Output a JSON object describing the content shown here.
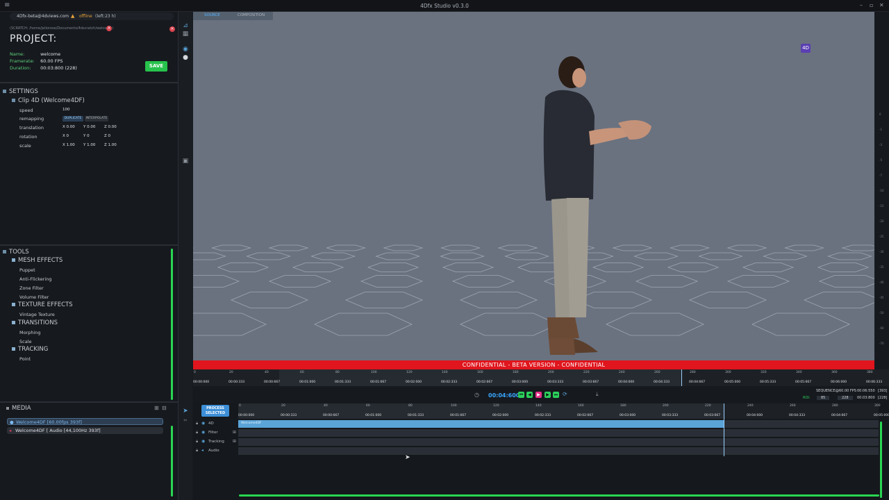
{
  "window": {
    "title": "4Dfx Studio v0.3.0"
  },
  "account": {
    "email": "4Dfx-beta@4dviews.com",
    "status": "offline",
    "remaining": "(left:23 h)"
  },
  "project": {
    "scratch_path": "(SCRATCH: /home/jeliorose/Documents/4dscratch/welcome)",
    "heading": "PROJECT:",
    "fields": [
      {
        "label": "Name:",
        "value": "welcome"
      },
      {
        "label": "Framerate:",
        "value": "60.00 FPS"
      },
      {
        "label": "Duration:",
        "value": "00:03:800 (228)"
      }
    ],
    "save_label": "SAVE"
  },
  "settings": {
    "heading": "SETTINGS",
    "clip": "Clip 4D (Welcome4DF)",
    "speed": {
      "label": "speed",
      "value": "100"
    },
    "remapping": {
      "label": "remapping",
      "options": [
        "DUPLICATE",
        "INTERPOLATE"
      ]
    },
    "translation": {
      "label": "translation",
      "x": "X 0.00",
      "y": "Y 0.00",
      "z": "Z 0.00"
    },
    "rotation": {
      "label": "rotation",
      "x": "X 0",
      "y": "Y 0",
      "z": "Z 0"
    },
    "scale": {
      "label": "scale",
      "x": "X 1.00",
      "y": "Y 1.00",
      "z": "Z 1.00"
    }
  },
  "tools": {
    "heading": "TOOLS",
    "groups": [
      {
        "name": "MESH EFFECTS",
        "items": [
          "Puppet",
          "Anti-Flickering",
          "Zone Filter",
          "Volume Filter"
        ]
      },
      {
        "name": "TEXTURE EFFECTS",
        "items": [
          "Vintage Texture"
        ]
      },
      {
        "name": "TRANSITIONS",
        "items": [
          "Morphing",
          "Scale"
        ]
      },
      {
        "name": "TRACKING",
        "items": [
          "Point"
        ]
      }
    ]
  },
  "media": {
    "heading": "MEDIA",
    "items": [
      "Welcome4DF [60.00fps 393f]",
      "Welcome4DF [ Audio [44,100Hz 393f]"
    ]
  },
  "viewport": {
    "tabs": [
      "SOURCE",
      "COMPOSITION"
    ],
    "badge": "4D",
    "banner": "CONFIDENTIAL - BETA VERSION - CONFIDENTIAL"
  },
  "source_ruler": {
    "frames": [
      "0",
      "20",
      "40",
      "60",
      "80",
      "100",
      "120",
      "140",
      "160",
      "180",
      "200",
      "220",
      "240",
      "260",
      "280",
      "300",
      "320",
      "340",
      "360",
      "380"
    ],
    "times": [
      "00:00:000",
      "00:00:333",
      "00:00:667",
      "00:01:000",
      "00:01:333",
      "00:01:667",
      "00:02:000",
      "00:02:333",
      "00:02:667",
      "00:03:000",
      "00:03:333",
      "00:03:667",
      "00:04:000",
      "00:04:333",
      "00:04:667",
      "00:05:000",
      "00:05:333",
      "00:05:667",
      "00:06:000",
      "00:06:333"
    ]
  },
  "transport": {
    "timecode": "00:04:600",
    "sequence_label": "SEQUENCE:",
    "sequence_fps": "@60.00 FPS",
    "sequence_time": "00:06:550",
    "sequence_frames": "[393]",
    "roi_label": "ROI:",
    "roi_start": "85",
    "roi_end": "228",
    "roi_time": "00:03:800",
    "roi_frames": "[228]"
  },
  "timeline": {
    "process_label": "PROCESS SELECTED",
    "frames": [
      "0",
      "20",
      "40",
      "60",
      "80",
      "100",
      "120",
      "140",
      "160",
      "180",
      "200",
      "220",
      "240",
      "260",
      "280",
      "300"
    ],
    "times": [
      "00:00:000",
      "00:00:333",
      "00:00:667",
      "00:01:000",
      "00:01:333",
      "00:01:667",
      "00:02:000",
      "00:02:333",
      "00:02:667",
      "00:03:000",
      "00:03:333",
      "00:03:667",
      "00:04:000",
      "00:04:333",
      "00:04:667",
      "00:05:000"
    ],
    "tracks": [
      {
        "name": "4D",
        "clip": "Welcome4DF"
      },
      {
        "name": "Filter"
      },
      {
        "name": "Tracking"
      },
      {
        "name": "Audio"
      }
    ]
  },
  "colors": {
    "accent": "#39a7ff",
    "save": "#27c24c",
    "banner": "#e0151d",
    "viewport": "#6a7280"
  }
}
